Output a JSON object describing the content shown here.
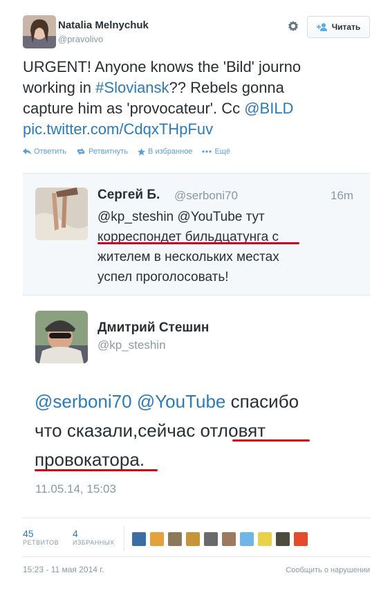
{
  "author": {
    "name": "Natalia Melnychuk",
    "handle": "@pravolivo"
  },
  "follow_button": {
    "label": "Читать"
  },
  "tweet": {
    "line1": "URGENT! Anyone knows the 'Bild' journo",
    "line2_a": "working in ",
    "line2_hashtag": "#Sloviansk",
    "line2_b": "?? Rebels gonna",
    "line3_a": "capture him as 'provocateur'. Cc ",
    "line3_mention": "@BILD",
    "line4_link": "pic.twitter.com/CdqxTHpFuv"
  },
  "actions": {
    "reply": "Ответить",
    "retweet": "Ретвитнуть",
    "favorite": "В избранное",
    "more": "Ещё"
  },
  "embed1": {
    "name": "Сергей Б.",
    "handle": "@serboni70",
    "time": "16m",
    "line1": "@kp_steshin @YouTube тут",
    "line2_a": "корреспондет бильдцатунга",
    "line2_b": " с",
    "line3": "жителем в нескольких местах",
    "line4": "успел проголосовать!"
  },
  "embed2": {
    "name": "Дмитрий Стешин",
    "handle": "@kp_steshin",
    "line1_mention1": "@serboni70",
    "line1_mention2": "@YouTube",
    "line1_rest": "спасибо",
    "line2_a": "что сказали,сейчас ",
    "line2_b": "отловят",
    "line3_a": "провокатора",
    "line3_b": ".",
    "date": "11.05.14, 15:03"
  },
  "stats": {
    "retweets_count": "45",
    "retweets_label": "РЕТВИТОВ",
    "favorites_count": "4",
    "favorites_label": "ИЗБРАННЫХ"
  },
  "footer": {
    "timestamp": "15:23 - 11 мая 2014 г.",
    "report": "Сообщить о нарушении"
  },
  "colors": {
    "link": "#2b7bb9",
    "underline": "#d0021b",
    "muted": "#8899a6"
  },
  "facepile_icons": [
    "avatar-1-icon",
    "avatar-2-icon",
    "avatar-3-icon",
    "avatar-4-icon",
    "avatar-5-icon",
    "avatar-6-icon",
    "avatar-7-icon",
    "avatar-8-icon",
    "avatar-9-icon",
    "avatar-10-icon"
  ]
}
